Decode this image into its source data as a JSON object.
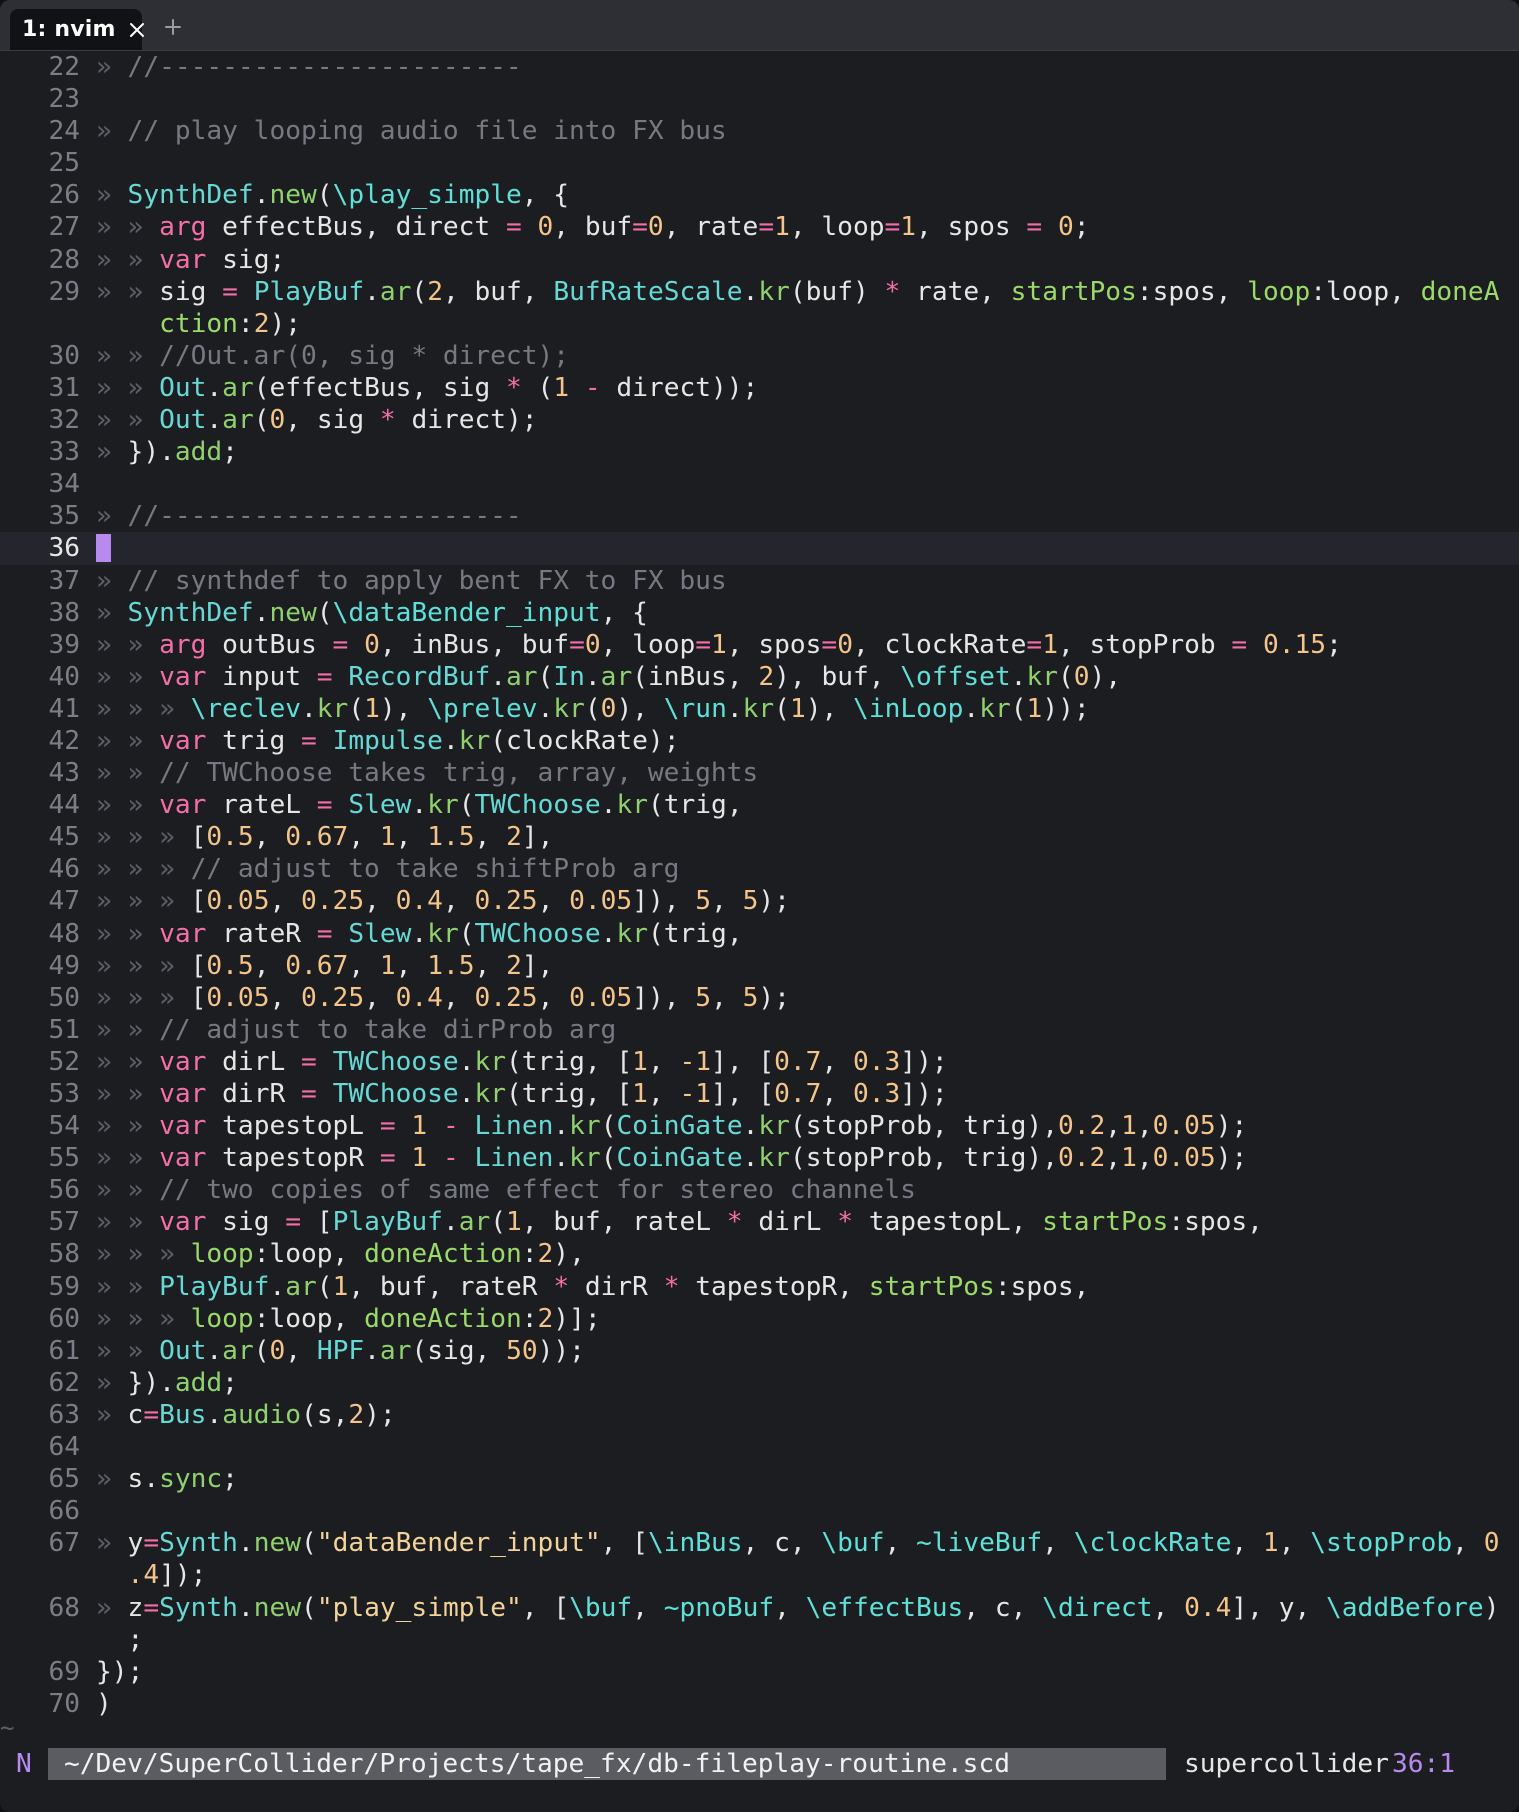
{
  "tab": {
    "title": "1: nvim",
    "close_icon": "close-icon",
    "new_tab_icon": "plus-icon"
  },
  "editor": {
    "gutter_arrow": "»",
    "lines": [
      {
        "num": "22",
        "text": "» //-----------------------"
      },
      {
        "num": "23",
        "text": ""
      },
      {
        "num": "24",
        "text": "» // play looping audio file into FX bus"
      },
      {
        "num": "25",
        "text": ""
      },
      {
        "num": "26",
        "text": "» SynthDef.new(\\play_simple, {"
      },
      {
        "num": "27",
        "text": "» » arg effectBus, direct = 0, buf=0, rate=1, loop=1, spos = 0;"
      },
      {
        "num": "28",
        "text": "» » var sig;"
      },
      {
        "num": "29",
        "text": "» » sig = PlayBuf.ar(2, buf, BufRateScale.kr(buf) * rate, startPos:spos, loop:loop, doneAction:2);"
      },
      {
        "num": "30",
        "text": "» » //Out.ar(0, sig * direct);"
      },
      {
        "num": "31",
        "text": "» » Out.ar(effectBus, sig * (1 - direct));"
      },
      {
        "num": "32",
        "text": "» » Out.ar(0, sig * direct);"
      },
      {
        "num": "33",
        "text": "» }).add;"
      },
      {
        "num": "34",
        "text": ""
      },
      {
        "num": "35",
        "text": "» //-----------------------"
      },
      {
        "num": "36",
        "text": ""
      },
      {
        "num": "37",
        "text": "» // synthdef to apply bent FX to FX bus"
      },
      {
        "num": "38",
        "text": "» SynthDef.new(\\dataBender_input, {"
      },
      {
        "num": "39",
        "text": "» » arg outBus = 0, inBus, buf=0, loop=1, spos=0, clockRate=1, stopProb = 0.15;"
      },
      {
        "num": "40",
        "text": "» » var input = RecordBuf.ar(In.ar(inBus, 2), buf, \\offset.kr(0),"
      },
      {
        "num": "41",
        "text": "» » » \\reclev.kr(1), \\prelev.kr(0), \\run.kr(1), \\inLoop.kr(1));"
      },
      {
        "num": "42",
        "text": "» » var trig = Impulse.kr(clockRate);"
      },
      {
        "num": "43",
        "text": "» » // TWChoose takes trig, array, weights"
      },
      {
        "num": "44",
        "text": "» » var rateL = Slew.kr(TWChoose.kr(trig,"
      },
      {
        "num": "45",
        "text": "» » » [0.5, 0.67, 1, 1.5, 2],"
      },
      {
        "num": "46",
        "text": "» » » // adjust to take shiftProb arg"
      },
      {
        "num": "47",
        "text": "» » » [0.05, 0.25, 0.4, 0.25, 0.05]), 5, 5);"
      },
      {
        "num": "48",
        "text": "» » var rateR = Slew.kr(TWChoose.kr(trig,"
      },
      {
        "num": "49",
        "text": "» » » [0.5, 0.67, 1, 1.5, 2],"
      },
      {
        "num": "50",
        "text": "» » » [0.05, 0.25, 0.4, 0.25, 0.05]), 5, 5);"
      },
      {
        "num": "51",
        "text": "» » // adjust to take dirProb arg"
      },
      {
        "num": "52",
        "text": "» » var dirL = TWChoose.kr(trig, [1, -1], [0.7, 0.3]);"
      },
      {
        "num": "53",
        "text": "» » var dirR = TWChoose.kr(trig, [1, -1], [0.7, 0.3]);"
      },
      {
        "num": "54",
        "text": "» » var tapestopL = 1 - Linen.kr(CoinGate.kr(stopProb, trig),0.2,1,0.05);"
      },
      {
        "num": "55",
        "text": "» » var tapestopR = 1 - Linen.kr(CoinGate.kr(stopProb, trig),0.2,1,0.05);"
      },
      {
        "num": "56",
        "text": "» » // two copies of same effect for stereo channels"
      },
      {
        "num": "57",
        "text": "» » var sig = [PlayBuf.ar(1, buf, rateL * dirL * tapestopL, startPos:spos,"
      },
      {
        "num": "58",
        "text": "» » » loop:loop, doneAction:2),"
      },
      {
        "num": "59",
        "text": "» » PlayBuf.ar(1, buf, rateR * dirR * tapestopR, startPos:spos,"
      },
      {
        "num": "60",
        "text": "» » » loop:loop, doneAction:2)];"
      },
      {
        "num": "61",
        "text": "» » Out.ar(0, HPF.ar(sig, 50));"
      },
      {
        "num": "62",
        "text": "» }).add;"
      },
      {
        "num": "63",
        "text": "» c=Bus.audio(s,2);"
      },
      {
        "num": "64",
        "text": ""
      },
      {
        "num": "65",
        "text": "» s.sync;"
      },
      {
        "num": "66",
        "text": ""
      },
      {
        "num": "67",
        "text": "» y=Synth.new(\"dataBender_input\", [\\inBus, c, \\buf, ~liveBuf, \\clockRate, 1, \\stopProb, 0.4]);"
      },
      {
        "num": "68",
        "text": "» z=Synth.new(\"play_simple\", [\\buf, ~pnoBuf, \\effectBus, c, \\direct, 0.4], y, \\addBefore);"
      },
      {
        "num": "69",
        "text": "});"
      },
      {
        "num": "70",
        "text": ")"
      }
    ],
    "end_of_buffer": "~",
    "cursor_line": "36"
  },
  "statusline": {
    "mode": "N",
    "filepath": "~/Dev/SuperCollider/Projects/tape_fx/db-fileplay-routine.scd",
    "filetype": "supercollider",
    "position": "36:1"
  },
  "colors": {
    "background": "#1c1d21",
    "cursorline": "#25262d",
    "cursor": "#b78af0",
    "keyword": "#f46faa",
    "class": "#66d9d6",
    "method": "#8fd16f",
    "number": "#f4c48a",
    "comment": "#767982",
    "symbol": "#5ee0d8",
    "mode_accent": "#b78af0"
  }
}
